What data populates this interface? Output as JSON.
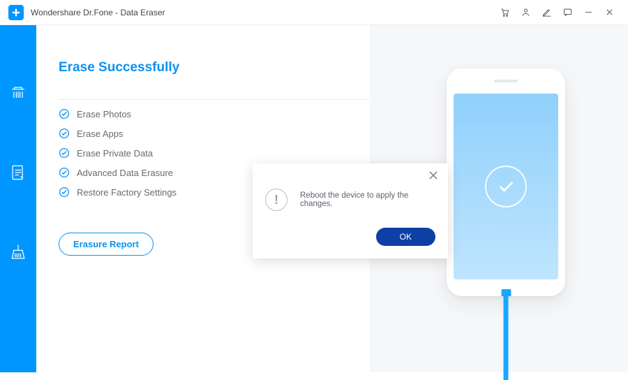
{
  "app": {
    "title": "Wondershare Dr.Fone - Data Eraser"
  },
  "heading": "Erase Successfully",
  "tasks": [
    {
      "label": "Erase Photos"
    },
    {
      "label": "Erase Apps"
    },
    {
      "label": "Erase Private Data"
    },
    {
      "label": "Advanced Data Erasure"
    },
    {
      "label": "Restore Factory Settings"
    }
  ],
  "report_button_label": "Erasure Report",
  "modal": {
    "message": "Reboot the device to apply the changes.",
    "ok_label": "OK"
  }
}
